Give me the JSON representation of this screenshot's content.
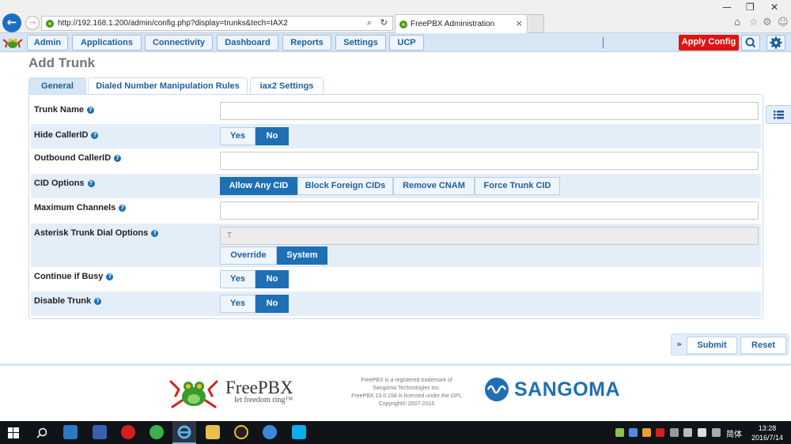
{
  "browser": {
    "url": "http://192.168.1.200/admin/config.php?display=trunks&tech=IAX2",
    "tab_title": "FreePBX Administration"
  },
  "nav": {
    "items": [
      "Admin",
      "Applications",
      "Connectivity",
      "Dashboard",
      "Reports",
      "Settings",
      "UCP"
    ],
    "apply_config": "Apply Config"
  },
  "page": {
    "title": "Add Trunk",
    "tabs": [
      "General",
      "Dialed Number Manipulation Rules",
      "iax2 Settings"
    ],
    "active_tab": "General"
  },
  "form": {
    "trunk_name": {
      "label": "Trunk Name",
      "value": ""
    },
    "hide_callerid": {
      "label": "Hide CallerID",
      "options": [
        "Yes",
        "No"
      ],
      "selected": "No"
    },
    "outbound_callerid": {
      "label": "Outbound CallerID",
      "value": ""
    },
    "cid_options": {
      "label": "CID Options",
      "options": [
        "Allow Any CID",
        "Block Foreign CIDs",
        "Remove CNAM",
        "Force Trunk CID"
      ],
      "selected": "Allow Any CID"
    },
    "maximum_channels": {
      "label": "Maximum Channels",
      "value": ""
    },
    "dial_options": {
      "label": "Asterisk Trunk Dial Options",
      "value": "T",
      "options": [
        "Override",
        "System"
      ],
      "selected": "System"
    },
    "continue_if_busy": {
      "label": "Continue if Busy",
      "options": [
        "Yes",
        "No"
      ],
      "selected": "No"
    },
    "disable_trunk": {
      "label": "Disable Trunk",
      "options": [
        "Yes",
        "No"
      ],
      "selected": "No"
    }
  },
  "actions": {
    "submit": "Submit",
    "reset": "Reset"
  },
  "footer": {
    "brand": "FreePBX",
    "tagline": "let freedom ring™",
    "legal": [
      "FreePBX is a registered trademark of",
      "Sangoma Technologies Inc.",
      "FreePBX 13.0.158 is licensed under the GPL",
      "Copyright© 2007-2016"
    ],
    "sangoma": "SANGOMA"
  },
  "taskbar": {
    "lang": "简体",
    "time": "13:28",
    "date": "2016/7/14"
  },
  "colors": {
    "accent": "#1f6fb5",
    "apply": "#e01414",
    "nav_bg": "#d6e6f5",
    "row_shade": "#e4eef8"
  }
}
